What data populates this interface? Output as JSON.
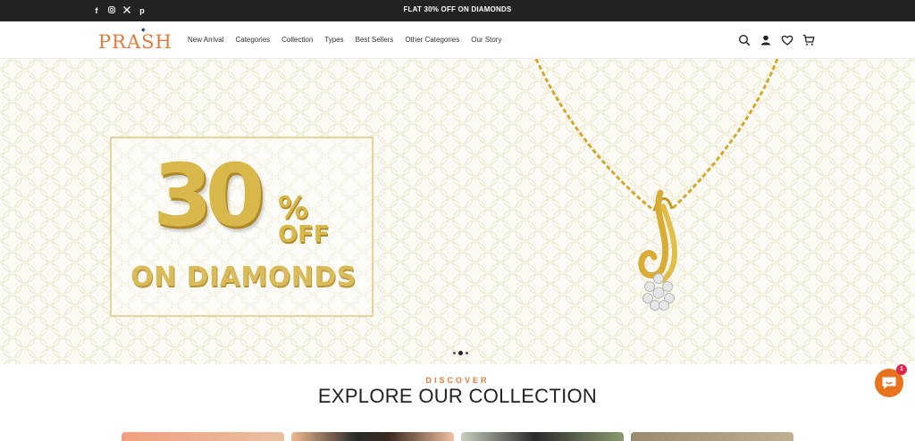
{
  "topbar": {
    "promo_text": "FLAT 30% OFF ON DIAMONDS",
    "social_icons": [
      "facebook-icon",
      "instagram-icon",
      "x-icon",
      "pinterest-icon"
    ]
  },
  "header": {
    "logo_text": "PRASH",
    "nav": [
      "New Arrival",
      "Categories",
      "Collection",
      "Types",
      "Best Sellers",
      "Other Categories",
      "Our Story"
    ],
    "icons": [
      "search-icon",
      "account-icon",
      "wishlist-icon",
      "cart-icon"
    ]
  },
  "hero": {
    "big_number": "30",
    "percent_sign": "%",
    "off_text": "OFF",
    "subline": "ON DIAMONDS",
    "slide_count": 3,
    "active_slide": 2
  },
  "collection": {
    "eyebrow": "DISCOVER",
    "title": "EXPLORE OUR COLLECTION"
  },
  "chat": {
    "badge_count": "1"
  },
  "colors": {
    "brand_orange": "#e07b3c",
    "gold": "#d8b84a",
    "topbar_bg": "#232323",
    "chat_bg": "#e8731c",
    "badge_bg": "#e3264b"
  }
}
